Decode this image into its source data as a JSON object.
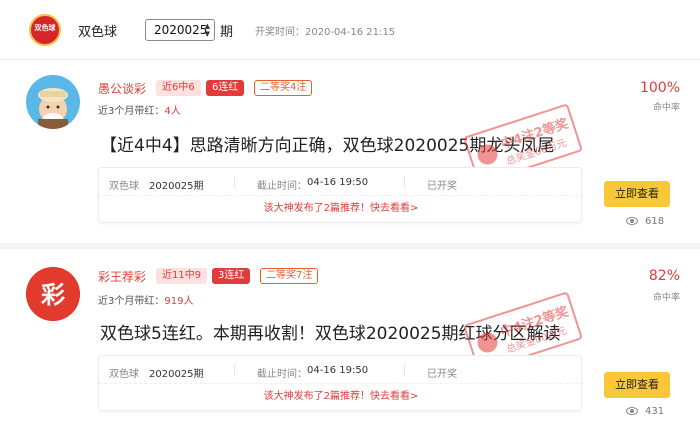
{
  "header": {
    "app_name": "双色球",
    "issue_value": "2020025",
    "issue_suffix": "期",
    "open_time": "开奖时间：2020-04-16 21:15"
  },
  "cards": [
    {
      "author": "愚公谈彩",
      "tag_recent": "近6中6",
      "tag_streak": "6连红",
      "tag_prize": "二等奖4注",
      "recent_label": "近3个月带红：",
      "recent_count": "4人",
      "title": "【近4中4】思路清晰方向正确，双色球2020025期龙头凤尾",
      "rate": "100%",
      "rate_label": "命中率",
      "info": {
        "game": "双色球",
        "issue": "2020025期",
        "deadline_label": "截止时间：",
        "deadline": "04-16 19:50",
        "status": "已开奖"
      },
      "promo": "该大神发布了2篇推荐！快去看看>",
      "view_button": "立即查看",
      "views": "618",
      "stamp": {
        "main": "中4注2等奖",
        "sub": "总奖金00万元"
      }
    },
    {
      "author": "彩王荐彩",
      "tag_recent": "近11中9",
      "tag_streak": "3连红",
      "tag_prize": "二等奖7注",
      "recent_label": "近3个月带红：",
      "recent_count": "919人",
      "title": "双色球5连红。本期再收割！双色球2020025期红球分区解读",
      "rate": "82%",
      "rate_label": "命中率",
      "info": {
        "game": "双色球",
        "issue": "2020025期",
        "deadline_label": "截止时间：",
        "deadline": "04-16 19:50",
        "status": "已开奖"
      },
      "promo": "该大神发布了2篇推荐！快去看看>",
      "view_button": "立即查看",
      "views": "431",
      "stamp": {
        "main": "中4注2等奖",
        "sub": "总奖金00万元"
      }
    }
  ],
  "icons": {
    "logo": "lottery-logo-icon",
    "eye": "eye-icon",
    "stamp": "prize-stamp-icon"
  },
  "colors": {
    "accent_red": "#e23b3b",
    "button_yellow": "#f8c83a",
    "tag_orange": "#e8602c"
  }
}
